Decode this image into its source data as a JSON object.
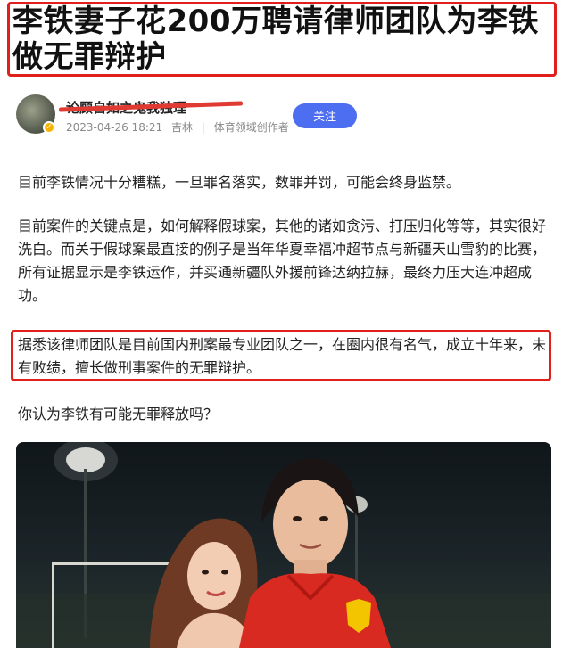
{
  "article": {
    "title": "李铁妻子花200万聘请律师团队为李铁做无罪辩护"
  },
  "author": {
    "name": "论顾自如之鬼我独理",
    "date": "2023-04-26 18:21",
    "location": "吉林",
    "tag": "体育领域创作者",
    "follow_label": "关注"
  },
  "body": {
    "p1": "目前李铁情况十分糟糕，一旦罪名落实，数罪并罚，可能会终身监禁。",
    "p2": "目前案件的关键点是，如何解释假球案，其他的诸如贪污、打压归化等等，其实很好洗白。而关于假球案最直接的例子是当年华夏幸福冲超节点与新疆天山雪豹的比赛，所有证据显示是李铁运作，并买通新疆队外援前锋达纳拉赫，最终力压大连冲超成功。",
    "p3": "据悉该律师团队是目前国内刑案最专业团队之一，在圈内很有名气，成立十年来，未有败绩，擅长做刑事案件的无罪辩护。",
    "p4": "你认为李铁有可能无罪释放吗？"
  },
  "colors": {
    "highlight_border": "#e0201a",
    "follow_button": "#4e6ef2",
    "meta_text": "#8a8a8a"
  }
}
